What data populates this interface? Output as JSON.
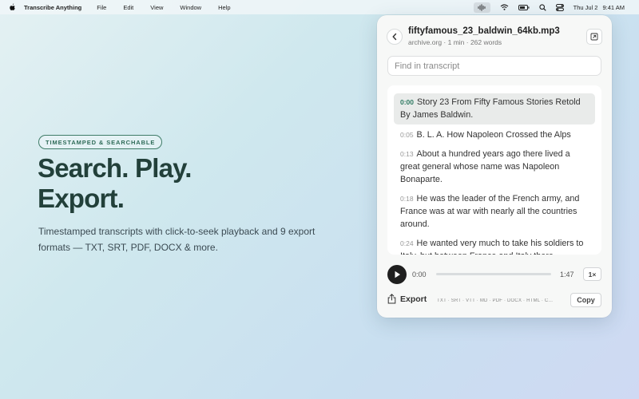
{
  "menubar": {
    "app_name": "Transcribe Anything",
    "items": [
      "File",
      "Edit",
      "View",
      "Window",
      "Help"
    ],
    "date": "Thu Jul 2",
    "time": "9:41 AM"
  },
  "hero": {
    "badge": "TIMESTAMPED & SEARCHABLE",
    "headline_line1": "Search. Play.",
    "headline_line2": "Export.",
    "subtext": "Timestamped transcripts with click-to-seek playback and 9 export formats — TXT, SRT, PDF, DOCX & more."
  },
  "panel": {
    "file_name": "fiftyfamous_23_baldwin_64kb.mp3",
    "file_meta": "archive.org · 1 min · 262 words",
    "search_placeholder": "Find in transcript",
    "segments": [
      {
        "ts": "0:00",
        "text": "Story 23 From Fifty Famous Stories Retold By James Baldwin."
      },
      {
        "ts": "0:05",
        "text": "B. L. A. How Napoleon Crossed the Alps"
      },
      {
        "ts": "0:13",
        "text": "About a hundred years ago there lived a great general whose name was Napoleon Bonaparte."
      },
      {
        "ts": "0:18",
        "text": "He was the leader of the French army, and France was at war with nearly all the countries around."
      },
      {
        "ts": "0:24",
        "text": "He wanted very much to take his soldiers to Italy, but between France and Italy there"
      }
    ],
    "player": {
      "current_time": "0:00",
      "duration": "1:47",
      "speed": "1×",
      "progress": 0
    },
    "export_label": "Export",
    "formats": "TXT · SRT · VTT · MD · PDF · DOCX · HTML · C...",
    "copy_label": "Copy"
  },
  "colors": {
    "accent_green": "#2f7a62",
    "headline": "#22403a"
  }
}
